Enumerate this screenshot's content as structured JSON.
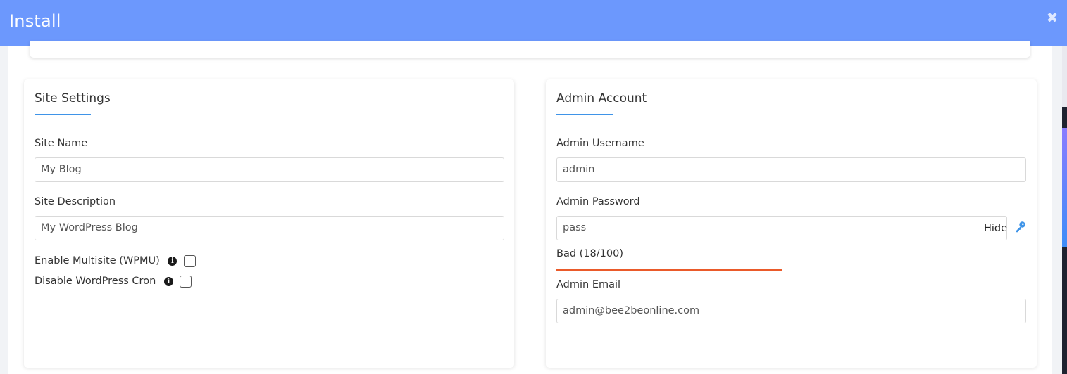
{
  "modal": {
    "title": "Install"
  },
  "site_settings": {
    "title": "Site Settings",
    "site_name": {
      "label": "Site Name",
      "value": "My Blog"
    },
    "site_description": {
      "label": "Site Description",
      "value": "My WordPress Blog"
    },
    "enable_multisite": {
      "label": "Enable Multisite (WPMU)",
      "checked": false
    },
    "disable_cron": {
      "label": "Disable WordPress Cron",
      "checked": false
    }
  },
  "admin_account": {
    "title": "Admin Account",
    "username": {
      "label": "Admin Username",
      "value": "admin"
    },
    "password": {
      "label": "Admin Password",
      "value": "pass",
      "toggle_label": "Hide"
    },
    "strength": {
      "label": "Bad (18/100)",
      "score": 18,
      "bar_fraction": 1.0,
      "color": "#ea5a2a"
    },
    "email": {
      "label": "Admin Email",
      "value": "admin@bee2beonline.com"
    }
  },
  "colors": {
    "header": "#6c98fd",
    "accent": "#3f94e8"
  },
  "icons": {
    "close": "close-icon",
    "info": "info-icon",
    "key": "key-icon"
  }
}
